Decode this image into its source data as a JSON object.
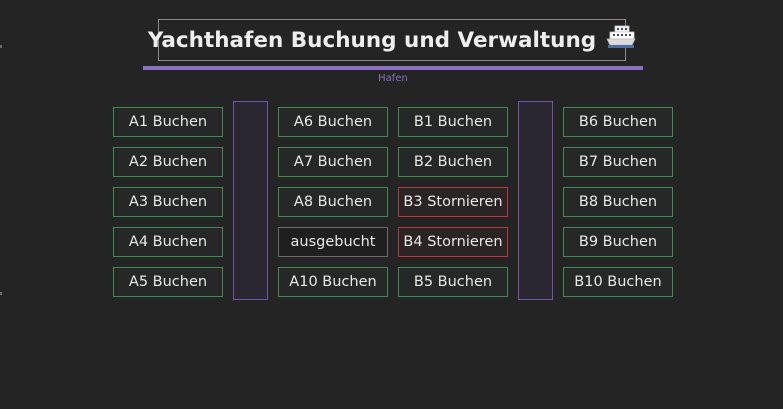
{
  "header": {
    "title": "Yachthafen Buchung und Verwaltung",
    "title_icon": "ship-icon",
    "subtitle": "Hafen"
  },
  "colors": {
    "background": "#242424",
    "accent": "#8b6fc0",
    "available_border": "#3f8a55",
    "cancel_border": "#b23a3a",
    "booked_border": "#6a6a6a"
  },
  "berths": {
    "col1": [
      {
        "label": "A1 Buchen",
        "state": "available"
      },
      {
        "label": "A2 Buchen",
        "state": "available"
      },
      {
        "label": "A3 Buchen",
        "state": "available"
      },
      {
        "label": "A4 Buchen",
        "state": "available"
      },
      {
        "label": "A5 Buchen",
        "state": "available"
      }
    ],
    "col2": [
      {
        "label": "A6 Buchen",
        "state": "available"
      },
      {
        "label": "A7 Buchen",
        "state": "available"
      },
      {
        "label": "A8 Buchen",
        "state": "available"
      },
      {
        "label": "ausgebucht",
        "state": "booked"
      },
      {
        "label": "A10 Buchen",
        "state": "available"
      }
    ],
    "col3": [
      {
        "label": "B1 Buchen",
        "state": "available"
      },
      {
        "label": "B2 Buchen",
        "state": "available"
      },
      {
        "label": "B3 Stornieren",
        "state": "cancel"
      },
      {
        "label": "B4 Stornieren",
        "state": "cancel"
      },
      {
        "label": "B5 Buchen",
        "state": "available"
      }
    ],
    "col4": [
      {
        "label": "B6 Buchen",
        "state": "available"
      },
      {
        "label": "B7 Buchen",
        "state": "available"
      },
      {
        "label": "B8 Buchen",
        "state": "available"
      },
      {
        "label": "B9 Buchen",
        "state": "available"
      },
      {
        "label": "B10 Buchen",
        "state": "available"
      }
    ]
  }
}
